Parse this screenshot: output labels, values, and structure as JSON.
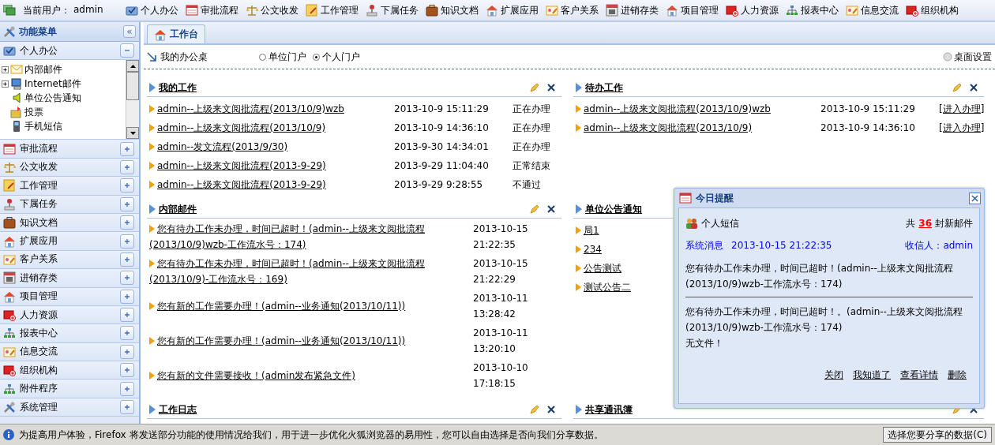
{
  "top_bar": {
    "user_label": "当前用户：",
    "user_name": "admin",
    "modules": [
      "个人办公",
      "审批流程",
      "公文收发",
      "工作管理",
      "下属任务",
      "知识文档",
      "扩展应用",
      "客户关系",
      "进销存类",
      "项目管理",
      "人力资源",
      "报表中心",
      "信息交流",
      "组织机构"
    ]
  },
  "sidebar": {
    "title": "功能菜单",
    "collapse": "«",
    "sections": [
      {
        "label": "个人办公",
        "expanded": true,
        "items": [
          {
            "label": "内部邮件",
            "kind": "branch"
          },
          {
            "label": "Internet邮件",
            "kind": "branch"
          },
          {
            "label": "单位公告通知",
            "kind": "leaf"
          },
          {
            "label": "投票",
            "kind": "leaf"
          },
          {
            "label": "手机短信",
            "kind": "leaf"
          }
        ]
      },
      {
        "label": "审批流程",
        "expanded": false
      },
      {
        "label": "公文收发",
        "expanded": false
      },
      {
        "label": "工作管理",
        "expanded": false
      },
      {
        "label": "下属任务",
        "expanded": false
      },
      {
        "label": "知识文档",
        "expanded": false
      },
      {
        "label": "扩展应用",
        "expanded": false
      },
      {
        "label": "客户关系",
        "expanded": false
      },
      {
        "label": "进销存类",
        "expanded": false
      },
      {
        "label": "项目管理",
        "expanded": false
      },
      {
        "label": "人力资源",
        "expanded": false
      },
      {
        "label": "报表中心",
        "expanded": false
      },
      {
        "label": "信息交流",
        "expanded": false
      },
      {
        "label": "组织机构",
        "expanded": false
      },
      {
        "label": "附件程序",
        "expanded": false
      },
      {
        "label": "系统管理",
        "expanded": false
      }
    ]
  },
  "tabs": [
    {
      "label": "工作台",
      "selected": true
    }
  ],
  "toolbar": {
    "title": "我的办公桌",
    "radios": [
      {
        "label": "单位门户",
        "selected": false
      },
      {
        "label": "个人门户",
        "selected": true
      }
    ],
    "settings": "桌面设置"
  },
  "portal": {
    "left": [
      {
        "title": "我的工作",
        "kind": "table",
        "rows": [
          {
            "title": "admin--上级来文阅批流程(2013/10/9)wzb",
            "time": "2013-10-9 15:11:29",
            "status": "正在办理"
          },
          {
            "title": "admin--上级来文阅批流程(2013/10/9)",
            "time": "2013-10-9 14:36:10",
            "status": "正在办理"
          },
          {
            "title": "admin--发文流程(2013/9/30)",
            "time": "2013-9-30 14:34:01",
            "status": "正在办理"
          },
          {
            "title": "admin--上级来文阅批流程(2013-9-29)",
            "time": "2013-9-29 11:04:40",
            "status": "正常结束"
          },
          {
            "title": "admin--上级来文阅批流程(2013-9-29)",
            "time": "2013-9-29 9:28:55",
            "status": "不通过"
          }
        ]
      },
      {
        "title": "内部邮件",
        "kind": "mail",
        "rows": [
          {
            "title": "您有待办工作未办理，时间已超时！(admin--上级来文阅批流程(2013/10/9)wzb-工作流水号：174)",
            "time": "2013-10-15 21:22:35"
          },
          {
            "title": "您有待办工作未办理，时间已超时！(admin--上级来文阅批流程(2013/10/9)-工作流水号：169)",
            "time": "2013-10-15 21:22:29"
          },
          {
            "title": "您有新的工作需要办理！(admin--业务通知(2013/10/11))",
            "time": "2013-10-11 13:28:42"
          },
          {
            "title": "您有新的工作需要办理！(admin--业务通知(2013/10/11))",
            "time": "2013-10-11 13:20:10"
          },
          {
            "title": "您有新的文件需要接收！(admin发布紧急文件)",
            "time": "2013-10-10 17:18:15"
          }
        ]
      },
      {
        "title": "工作日志"
      }
    ],
    "right": [
      {
        "title": "待办工作",
        "kind": "table",
        "rows": [
          {
            "title": "admin--上级来文阅批流程(2013/10/9)wzb",
            "time": "2013-10-9 15:11:29",
            "status": "[进入办理]"
          },
          {
            "title": "admin--上级来文阅批流程(2013/10/9)",
            "time": "2013-10-9 14:36:10",
            "status": "[进入办理]"
          }
        ]
      },
      {
        "title": "单位公告通知",
        "kind": "list",
        "rows": [
          {
            "title": "局1"
          },
          {
            "title": "234"
          },
          {
            "title": "公告测试"
          },
          {
            "title": "测试公告二"
          }
        ]
      },
      {
        "title": "共享通讯簿"
      }
    ]
  },
  "popup": {
    "title": "今日提醒",
    "category": "个人短信",
    "count_prefix": "共",
    "count": "36",
    "count_suffix": "封新邮件",
    "sender": "系统消息",
    "time": "2013-10-15 21:22:35",
    "recipient": "收信人：admin",
    "messages": [
      "您有待办工作未办理，时间已超时！(admin--上级来文阅批流程(2013/10/9)wzb-工作流水号：174)",
      "您有待办工作未办理，时间已超时！。(admin--上级来文阅批流程(2013/10/9)wzb-工作流水号：174)"
    ],
    "attachment": "无文件！",
    "actions": [
      "关闭",
      "我知道了",
      "查看详情",
      "删除"
    ]
  },
  "notice_bar": {
    "text": "为提高用户体验，Firefox 将发送部分功能的使用情况给我们，用于进一步优化火狐浏览器的易用性，您可以自由选择是否向我们分享数据。",
    "button": "选择您要分享的数据(C)"
  }
}
